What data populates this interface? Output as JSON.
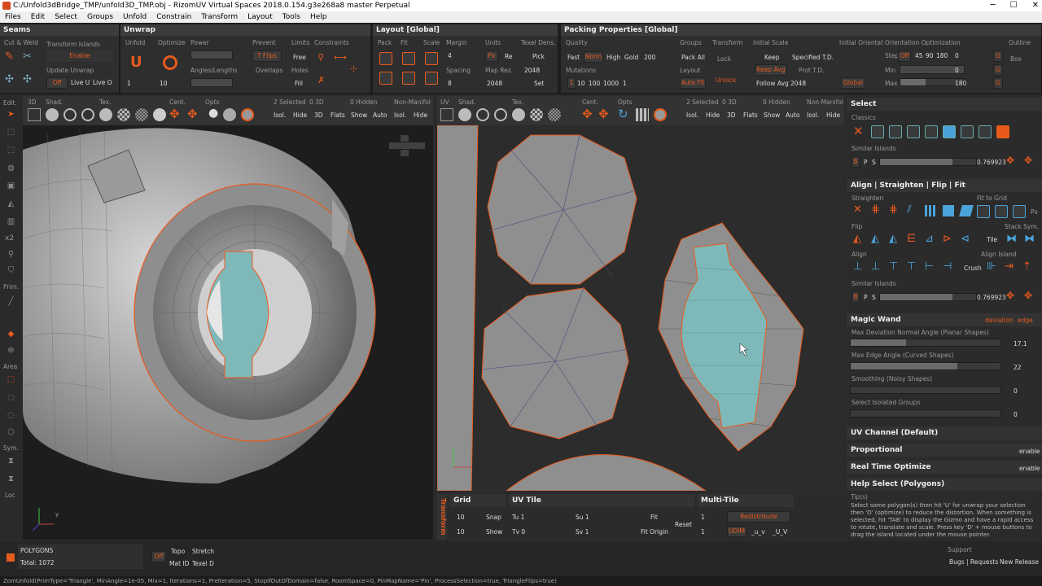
{
  "window": {
    "title": "C:/Unfold3dBridge_TMP/unfold3D_TMP.obj - RizomUV  Virtual Spaces 2018.0.154.g3e268a8 master Perpetual"
  },
  "menu": [
    "Files",
    "Edit",
    "Select",
    "Groups",
    "Unfold",
    "Constrain",
    "Transform",
    "Layout",
    "Tools",
    "Help"
  ],
  "seams": {
    "title": "Seams",
    "cut_weld": "Cut & Weld",
    "transform_islands": "Transform Islands",
    "enable": "Enable",
    "update_unwrap": "Update Unwrap",
    "off": "Off",
    "live_u": "Live U",
    "live_o": "Live O"
  },
  "unwrap": {
    "title": "Unwrap",
    "unfold": "Unfold",
    "optimize": "Optimize",
    "power": "Power",
    "angles_lengths": "Angles/Lengths",
    "prevent": "Prevent",
    "tflips": "T Flips",
    "overlaps": "Overlaps",
    "limits": "Limits",
    "free": "Free",
    "holes": "Holes",
    "fill": "Fill",
    "constraints": "Constraints",
    "unfold_val": "1",
    "optimize_val": "10"
  },
  "layout": {
    "title": "Layout [Global]",
    "pack": "Pack",
    "fit": "Fit",
    "scale": "Scale",
    "margin": "Margin",
    "margin_val": "4",
    "spacing": "Spacing",
    "spacing_val": "8",
    "units": "Units",
    "px": "Px",
    "re": "Re",
    "map_res": "Map Rez.",
    "map_res_val1": "2048",
    "map_res_val2": "2048",
    "texel_dens": "Texel Dens.",
    "pick": "Pick",
    "set": "Set"
  },
  "packing": {
    "title": "Packing Properties [Global]",
    "quality": "Quality",
    "fast": "Fast",
    "norm": "Norm",
    "high": "High",
    "gold": "Gold",
    "gold_val": "200",
    "mutations": "Mutations",
    "mut_vals": [
      "1",
      "10",
      "100",
      "1000",
      "1"
    ],
    "groups": "Groups",
    "pack_all": "Pack All",
    "layout": "Layout",
    "auto_fit": "Auto Fit",
    "transform": "Transform",
    "lock": "Lock",
    "unlock": "Unlock",
    "initial_scale": "Initial Scale",
    "keep": "Keep",
    "keep_avg": "Keep Avg",
    "follow_avg": "Follow Avg",
    "follow_val": "2048",
    "specified_td": "Specified T.D.",
    "prot_td": "Prot T.D.",
    "initial_orient": "Initial Orientat",
    "global": "Global",
    "orient_opt": "Orientation Optimization",
    "step": "Step",
    "step_off": "Off",
    "step_vals": [
      "45",
      "90",
      "180",
      "0"
    ],
    "min": "Min",
    "min_val": "0",
    "max": "Max",
    "max_val": "180",
    "outline": "Outline",
    "box": "Box",
    "g": "G"
  },
  "vp3d": {
    "labels": [
      "3D",
      "Shad.",
      "Tex.",
      "Cent.",
      "Opts"
    ],
    "selected": "2 Selected",
    "zero_3d": "0 3D",
    "hidden": "0 Hidden",
    "non_manifold": "Non-Manifol",
    "row2": [
      "Isol.",
      "Hide",
      "3D",
      "Flats",
      "Show",
      "Auto",
      "Isol.",
      "Hide"
    ]
  },
  "vpuv": {
    "labels": [
      "UV",
      "Shad.",
      "Tex.",
      "Cent.",
      "Opts"
    ],
    "selected": "2 Selected",
    "zero_3d": "0 3D",
    "hidden": "0 Hidden",
    "non_manifold": "Non-Manifol",
    "row2": [
      "Isol.",
      "Hide",
      "3D",
      "Flats",
      "Show",
      "Auto",
      "Isol.",
      "Hide"
    ]
  },
  "leftbar": {
    "edit": "Edit.",
    "x2": "x2",
    "prim": "Prim.",
    "area": "Area",
    "sym": "Sym.",
    "loc": "Loc"
  },
  "select": {
    "title": "Select",
    "classics": "Classics",
    "similar_islands": "Similar Islands",
    "similar_val": "0.769923",
    "b": "B",
    "p": "P",
    "s": "S"
  },
  "align": {
    "title": "Align | Straighten | Flip | Fit",
    "straighten": "Straighten",
    "fit_to_grid": "Fit to Grid",
    "flip": "Flip",
    "stack_sym": "Stack Sym.",
    "tile": "Tile",
    "align": "Align",
    "align_island": "Align Island",
    "crush": "Crush",
    "similar_islands": "Similar Islands",
    "similar_val": "0.769923",
    "px": "Px"
  },
  "magic": {
    "title": "Magic Wand",
    "deviation": "deviation",
    "edge": "edge",
    "max_dev": "Max Deviation Normal Angle (Planar Shapes)",
    "max_dev_val": "17.1",
    "max_edge": "Max Edge Angle (Curved Shapes)",
    "max_edge_val": "22",
    "smoothing": "Smoothing (Noisy Shapes)",
    "smoothing_val": "0",
    "isolated": "Select Isolated Groups",
    "isolated_val": "0"
  },
  "uvchannel": {
    "title": "UV Channel (Default)"
  },
  "proportional": {
    "title": "Proportional",
    "btn": "enable"
  },
  "rto": {
    "title": "Real Time Optimize",
    "btn": "enable"
  },
  "help": {
    "title": "Help Select (Polygons)",
    "tips": "Tip(s)",
    "text": "Select some polygon(s) then hit 'U' for unwrap your selection then 'O' (optimize) to reduce the distortion. When something is selected, hit 'TAB' to display the Gizmo and have a rapid access to rotate, translate and scale. Press key 'D' + mouse buttons to drag the island located under the mouse pointer."
  },
  "bottom": {
    "transform": "Transform",
    "grid": "Grid",
    "grid_v1": "10",
    "grid_v2": "10",
    "snap": "Snap",
    "show": "Show",
    "uvtile": "UV Tile",
    "tu": "Tu 1",
    "tv": "Tv 0",
    "su": "Su 1",
    "sv": "Sv 1",
    "fit": "Fit",
    "fit_origin": "Fit Origin",
    "reset": "Reset",
    "multitile": "Multi-Tile",
    "mt_v1": "1",
    "mt_v2": "1",
    "redistribute": "Redistribute",
    "udim": "UDIM",
    "u_v": "_u_v",
    "U_V": "_U_V"
  },
  "status": {
    "mode": "POLYGONS",
    "total": "Total: 1072",
    "off": "Off",
    "topo": "Topo",
    "stretch": "Stretch",
    "matid": "Mat ID",
    "texeld": "Texel D",
    "support": "Support",
    "bugs": "Bugs | Requests",
    "new_release": "New Release"
  },
  "cmd": "ZomUnfold(PrimType='Triangle', MinAngle=1e-05, Mix=1, Iterations=1, PreIteration=5, StopIfOutOfDomain=false, RoomSpace=0, PinMapName='Pin', ProcessSelection=true, TriangleFlips=true)",
  "colors": {
    "accent": "#e85a1c",
    "bg": "#2b2b2b",
    "selected_island": "#7fb8b8"
  }
}
